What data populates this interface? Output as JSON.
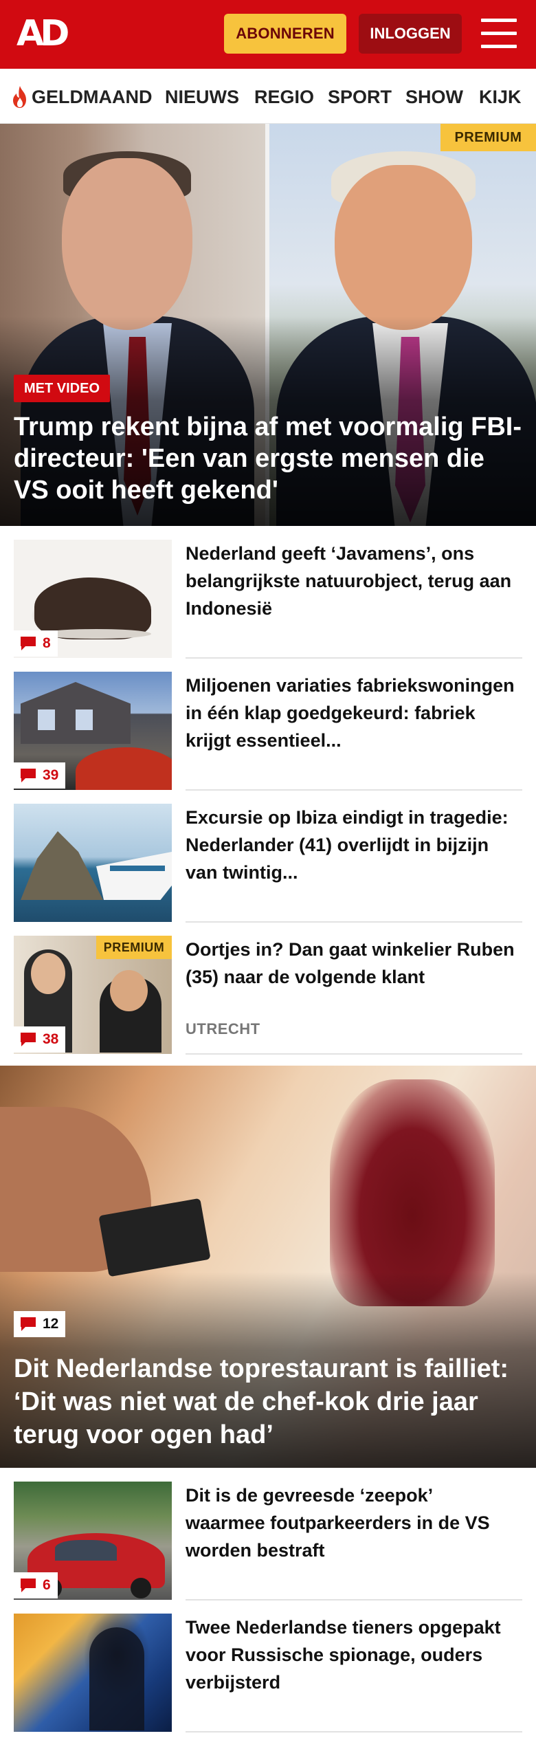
{
  "header": {
    "logo": "AD",
    "subscribe_label": "ABONNEREN",
    "login_label": "INLOGGEN"
  },
  "nav": {
    "items": [
      "GELDMAAND",
      "NIEUWS",
      "REGIO",
      "SPORT",
      "SHOW",
      "KIJK"
    ]
  },
  "hero": {
    "premium": "PREMIUM",
    "video_badge": "MET VIDEO",
    "title": "Trump rekent bijna af met voormalig FBI-directeur: 'Een van ergste mensen die VS ooit heeft gekend'"
  },
  "articles": [
    {
      "title": "Nederland geeft ‘Javamens’, ons belangrijkste natuurobject, terug aan Indonesië",
      "comments": "8"
    },
    {
      "title": "Miljoenen variaties fabriekswo­ningen in één klap goedgekeurd: fabriek krijgt essentieel...",
      "comments": "39"
    },
    {
      "title": "Excursie op Ibiza eindigt in tragedie: Nederlander (41) overlijdt in bijzijn van twintig..."
    },
    {
      "title": "Oortjes in? Dan gaat winkelier Ruben (35) naar de volgende klant",
      "comments": "38",
      "premium": "PREMIUM",
      "region": "UTRECHT"
    }
  ],
  "big_article": {
    "comments": "12",
    "title": "Dit Nederlandse toprestaurant is failliet: ‘Dit was niet wat de chef-kok drie jaar terug voor ogen had’"
  },
  "articles_bottom": [
    {
      "title": "Dit is de gevreesde ‘zeepok’ waarmee foutparkeerders in de VS worden bestraft",
      "comments": "6"
    },
    {
      "title": "Twee Nederlandse tieners opgepakt voor Russische spionage, ouders verbijsterd"
    }
  ],
  "colors": {
    "brand_red": "#d10a11",
    "premium_yellow": "#f7c33d",
    "login_dark_red": "#9d0d12"
  }
}
